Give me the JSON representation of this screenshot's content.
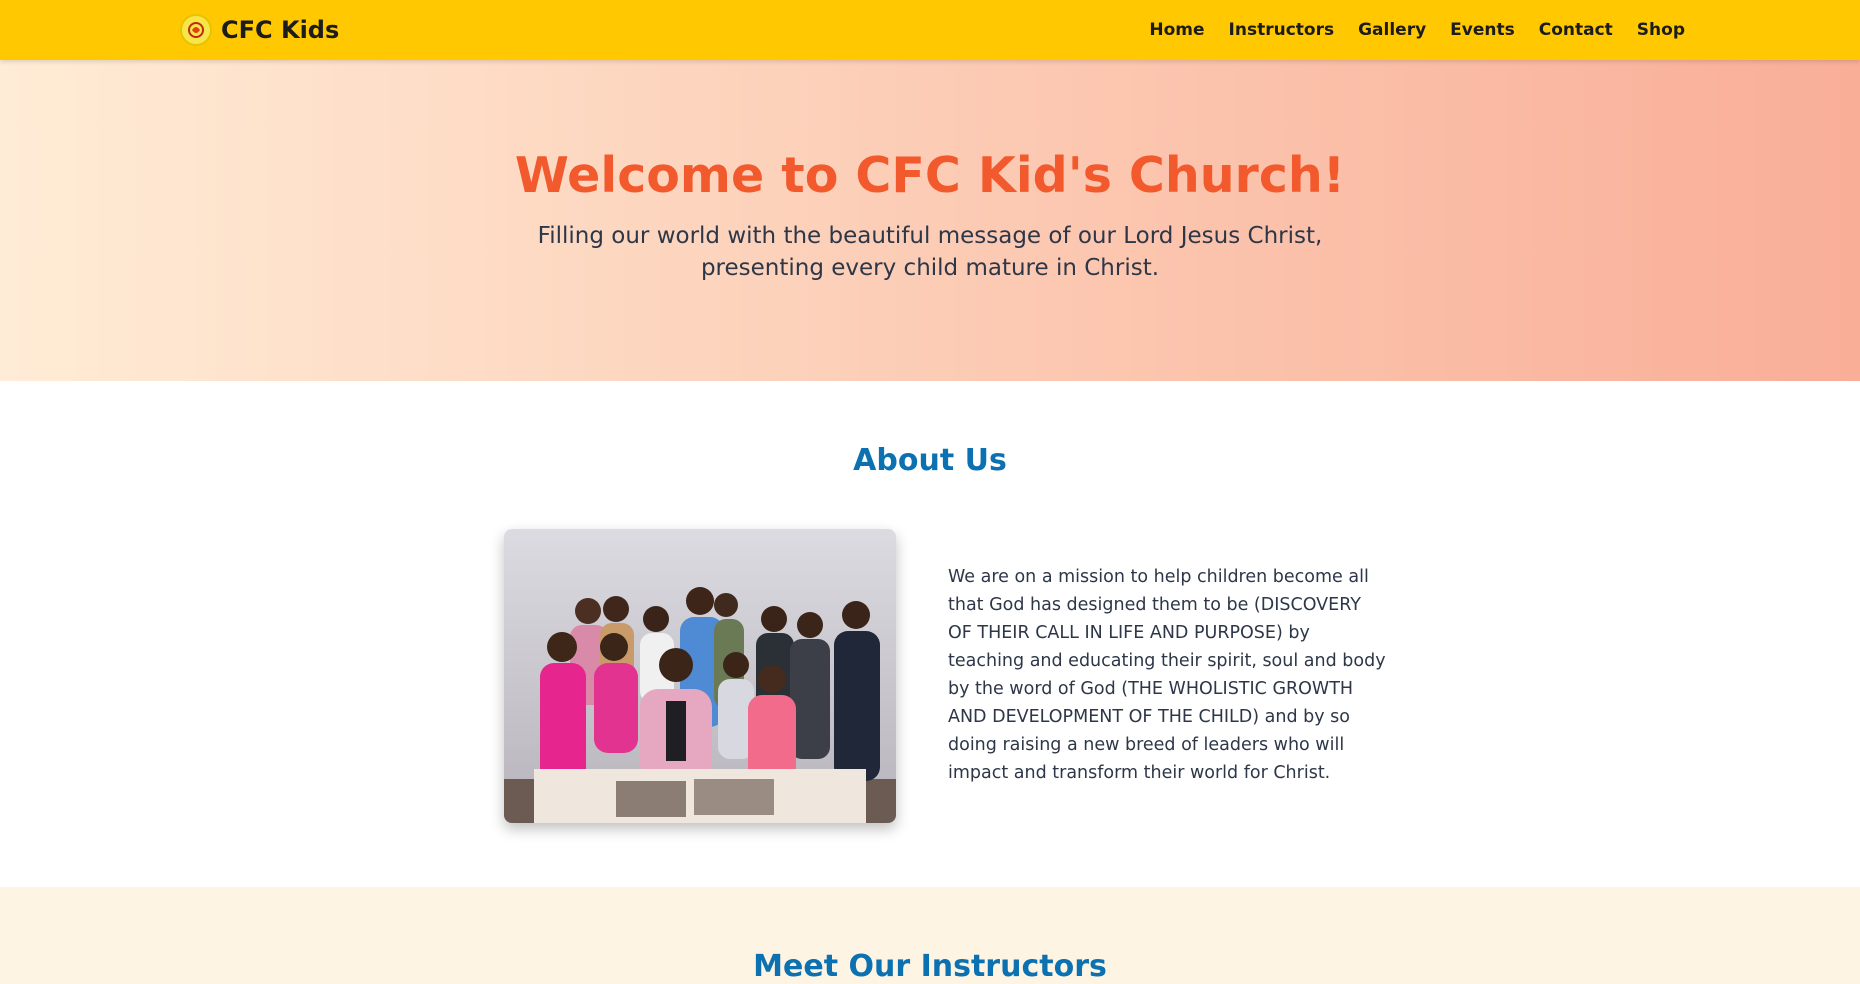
{
  "brand": {
    "name": "CFC Kids"
  },
  "nav": {
    "items": [
      "Home",
      "Instructors",
      "Gallery",
      "Events",
      "Contact",
      "Shop"
    ]
  },
  "hero": {
    "title": "Welcome to CFC Kid's Church!",
    "subtitle": "Filling our world with the beautiful message of our Lord Jesus Christ, presenting every child mature in Christ."
  },
  "about": {
    "title": "About Us",
    "text": "We are on a mission to help children become all that God has designed them to be (DISCOVERY OF THEIR CALL IN LIFE AND PURPOSE) by teaching and educating their spirit, soul and body by the word of God (THE WHOLISTIC GROWTH AND DEVELOPMENT OF THE CHILD) and by so doing raising a new breed of leaders who will impact and transform their world for Christ."
  },
  "instructors": {
    "title": "Meet Our Instructors"
  },
  "colors": {
    "navbar": "#ffc800",
    "hero_title": "#f2592d",
    "section_title": "#0c71b0",
    "instructors_bg": "#fdf4e3"
  }
}
